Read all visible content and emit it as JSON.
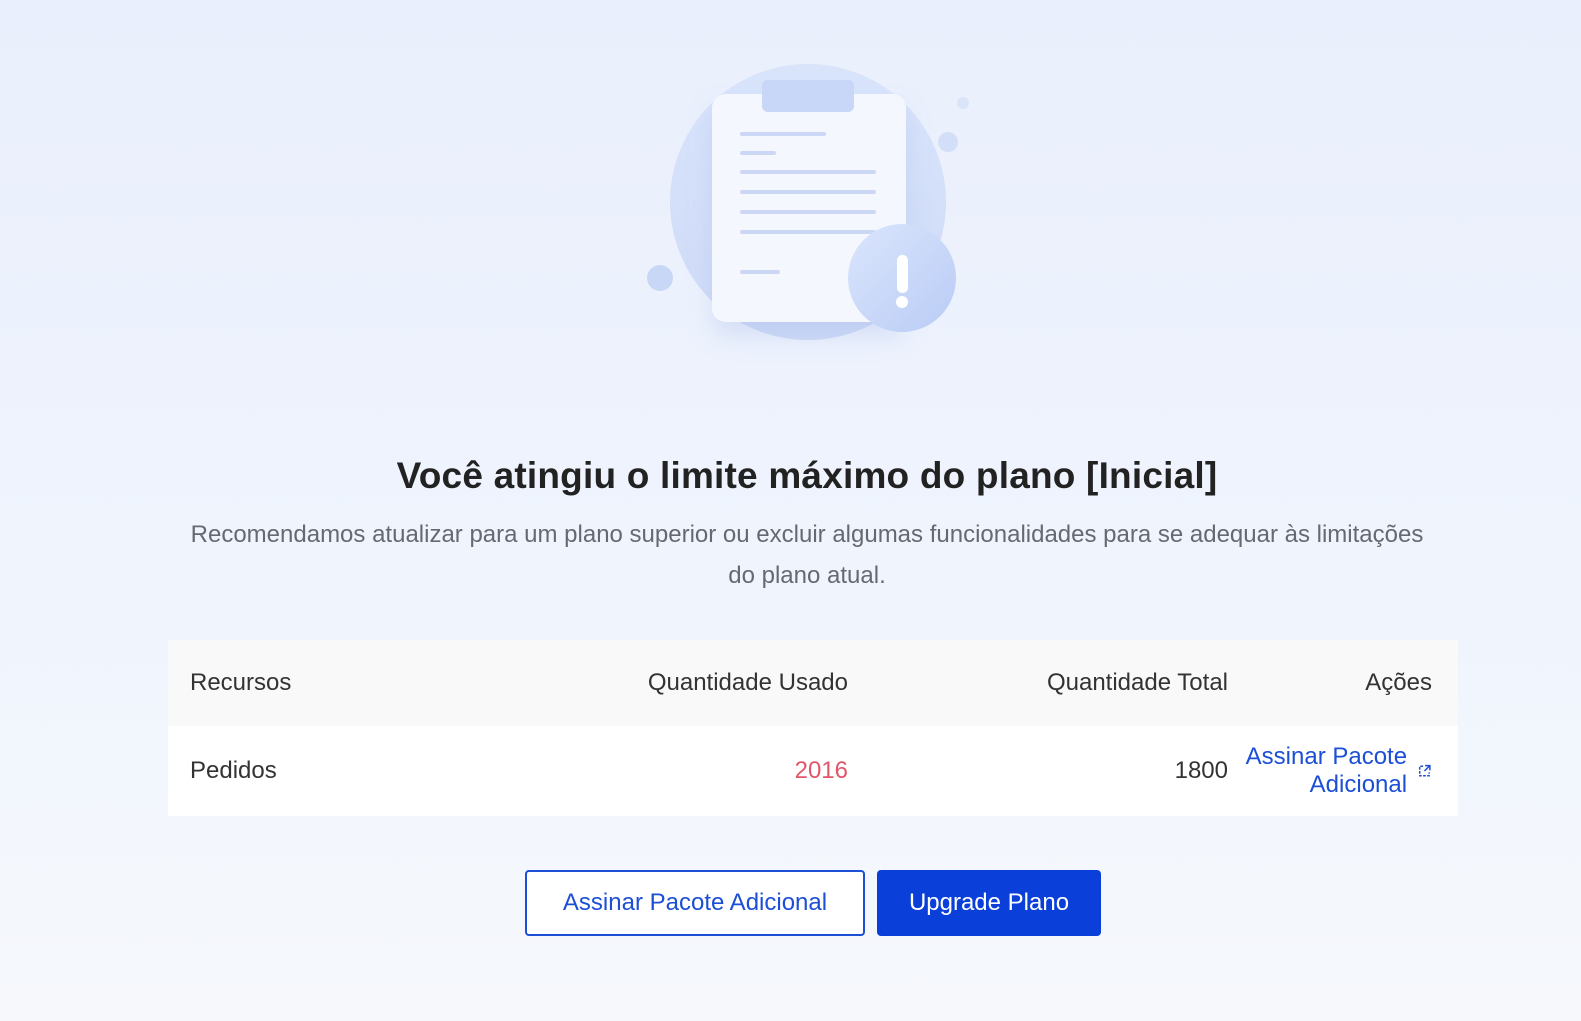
{
  "colors": {
    "accent": "#0a3fd9",
    "link": "#1c4fd6",
    "exceeded": "#e0576a",
    "background": "#eef3fd"
  },
  "illustration": {
    "icons": [
      "clipboard-icon",
      "warning-badge-icon"
    ]
  },
  "alert": {
    "title": "Você atingiu o limite máximo do plano [Inicial]",
    "description": "Recomendamos atualizar para um plano superior ou excluir algumas funcionalidades para se adequar às limitações do plano atual."
  },
  "table": {
    "headers": {
      "resource": "Recursos",
      "used": "Quantidade Usado",
      "total": "Quantidade Total",
      "actions": "Ações"
    },
    "rows": [
      {
        "resource": "Pedidos",
        "used": "2016",
        "total": "1800",
        "action_label": "Assinar Pacote Adicional",
        "action_icon": "external-link-icon"
      }
    ]
  },
  "buttons": {
    "secondary_label": "Assinar Pacote Adicional",
    "primary_label": "Upgrade Plano"
  }
}
